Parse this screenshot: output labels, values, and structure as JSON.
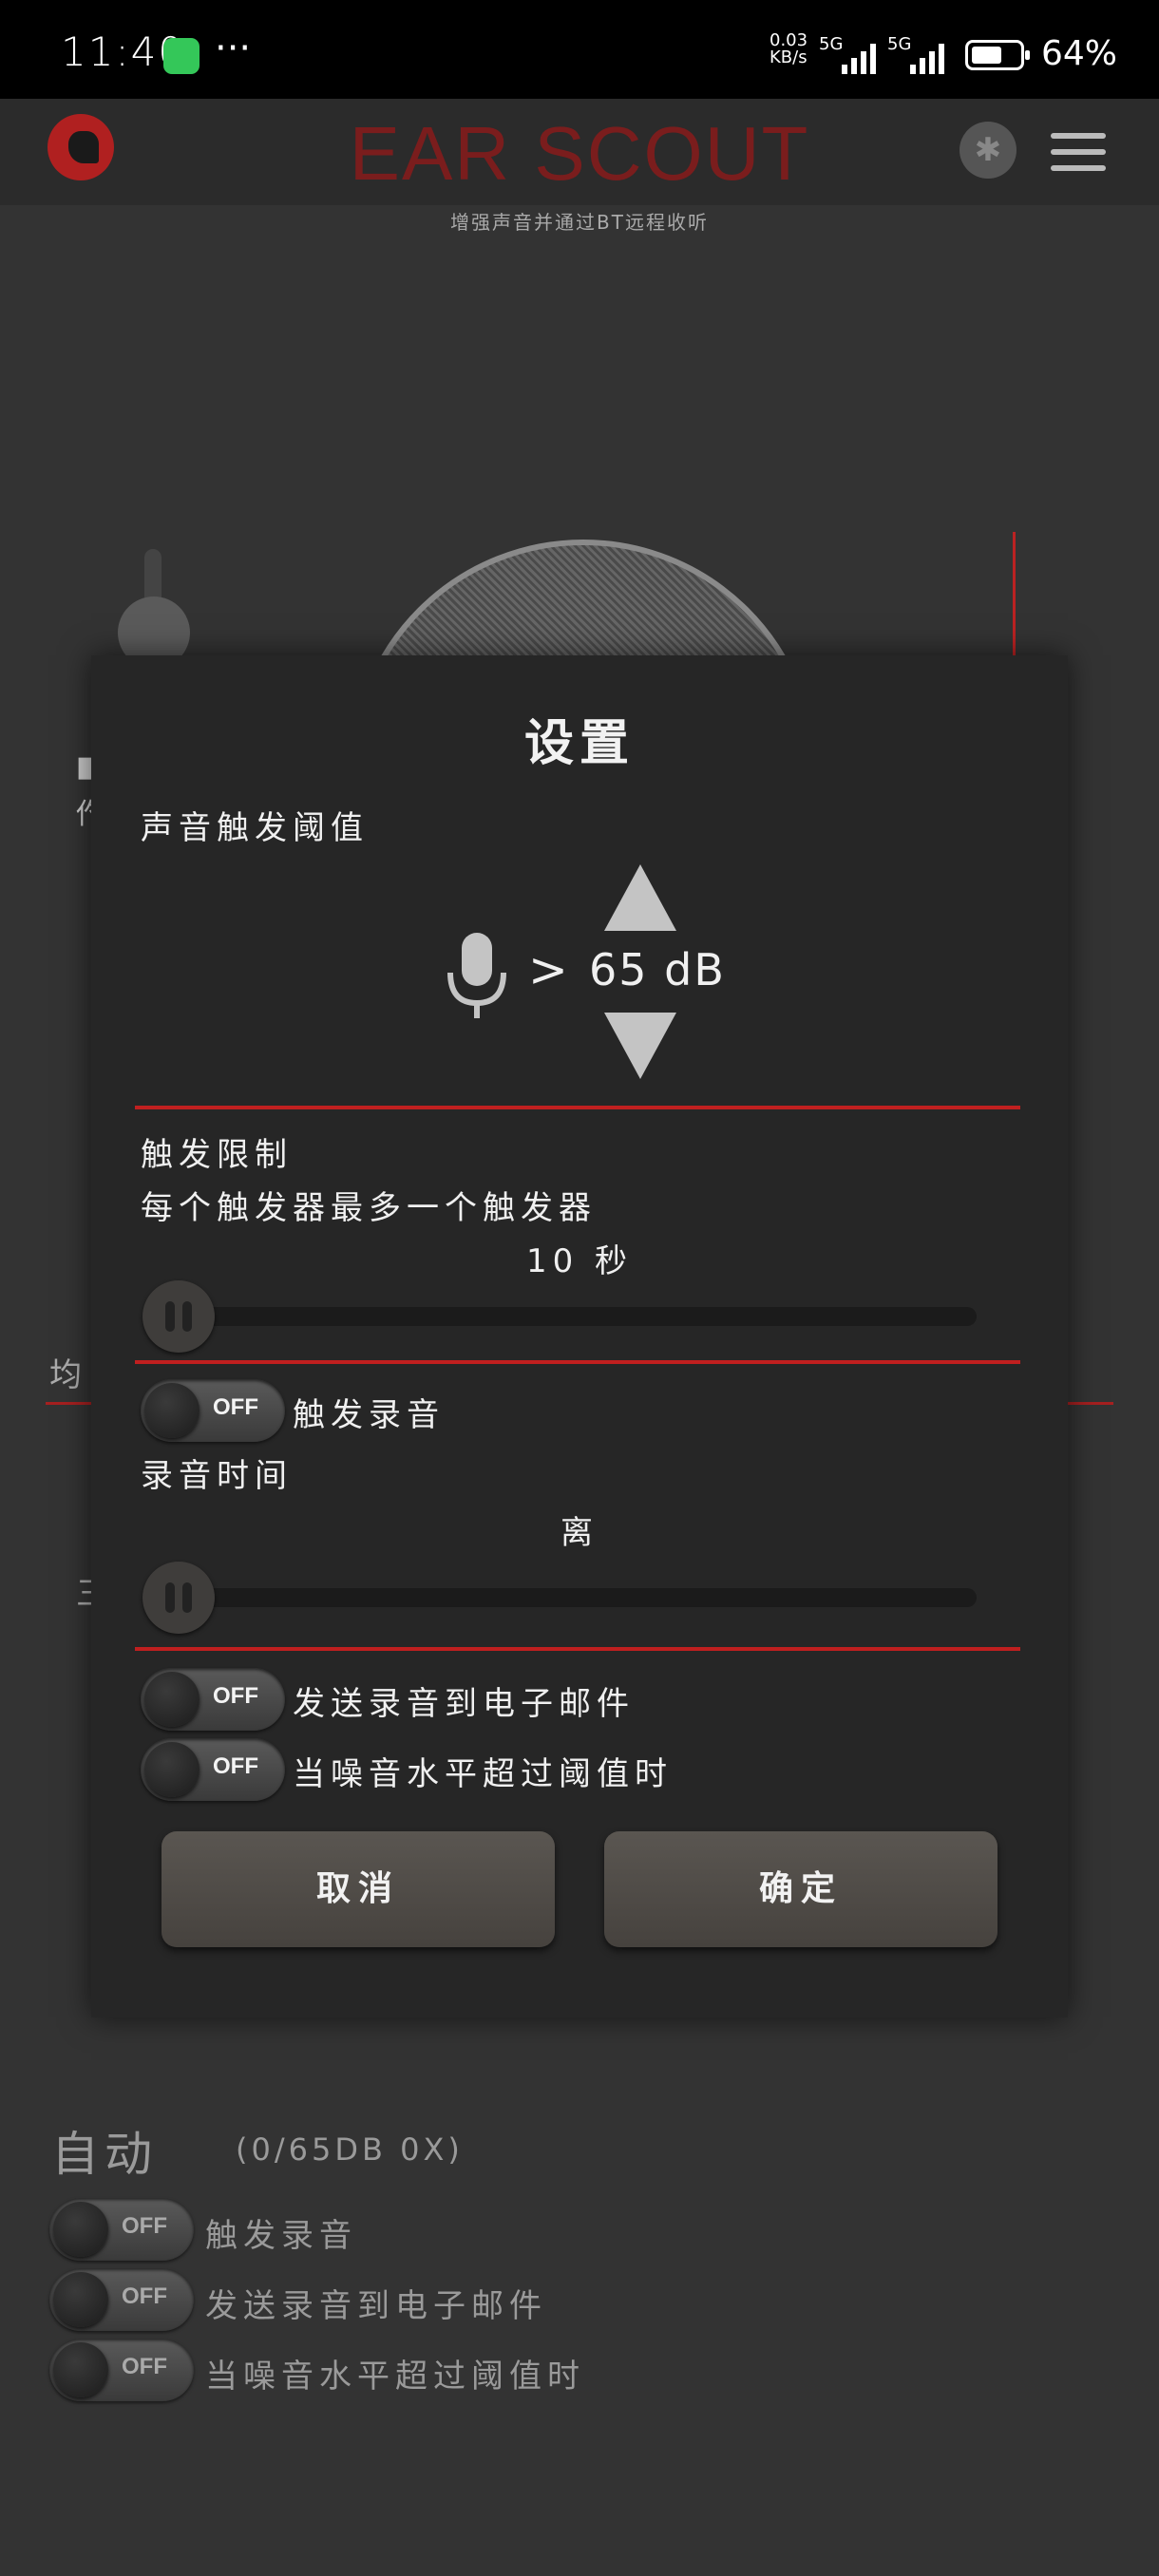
{
  "status_bar": {
    "time": "11:40",
    "more": "···",
    "net_speed_value": "0.03",
    "net_speed_unit": "KB/s",
    "sim1": "5G",
    "sim2": "5G",
    "battery": "64%",
    "battery_level": 0.64,
    "app_icon": "green-app-icon"
  },
  "app": {
    "title": "EAR SCOUT",
    "subtitle": "增强声音并通过BT远程收听",
    "icons": [
      "logo-icon",
      "bluetooth-icon",
      "menu-icon"
    ],
    "accent": "#c01f1f"
  },
  "background": {
    "left_text_1": "■",
    "left_text_2": "仢",
    "eq_label": "均",
    "three_label": "三"
  },
  "auto_section": {
    "title": "自动",
    "meta": "(0/65DB    0X)",
    "rows": [
      {
        "state": "OFF",
        "label": "触发录音"
      },
      {
        "state": "OFF",
        "label": "发送录音到电子邮件"
      },
      {
        "state": "OFF",
        "label": "当噪音水平超过阈值时"
      }
    ]
  },
  "dialog": {
    "title": "设置",
    "threshold_label": "声音触发阈值",
    "gt": ">",
    "db_value": "65 dB",
    "trigger_limit_label": "触发限制",
    "trigger_limit_desc": "每个触发器最多一个触发器",
    "trigger_limit_value": "10 秒",
    "record_toggle": {
      "state": "OFF",
      "label": "触发录音"
    },
    "record_time_label": "录音时间",
    "record_time_value": "离",
    "email_toggle": {
      "state": "OFF",
      "label": "发送录音到电子邮件"
    },
    "noise_toggle": {
      "state": "OFF",
      "label": "当噪音水平超过阈值时"
    },
    "cancel": "取消",
    "confirm": "确定"
  }
}
